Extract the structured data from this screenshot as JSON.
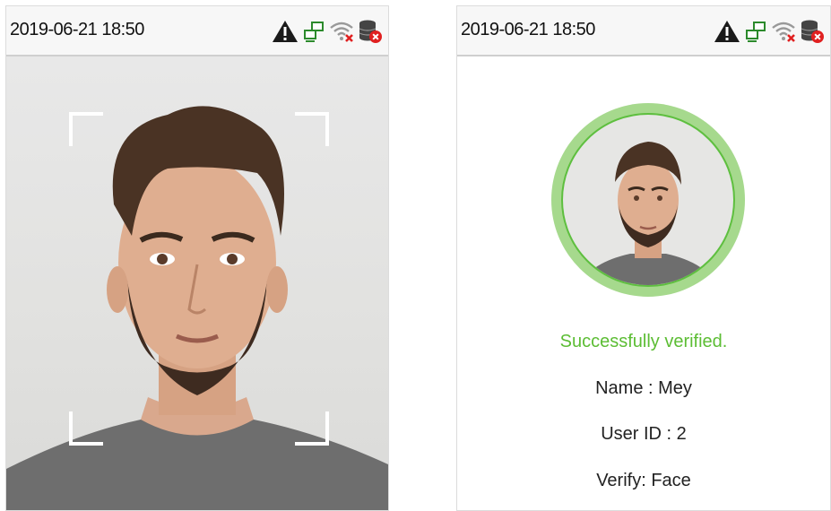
{
  "left_screen": {
    "status_bar": {
      "datetime": "2019-06-21 18:50"
    }
  },
  "right_screen": {
    "status_bar": {
      "datetime": "2019-06-21 18:50"
    },
    "result": {
      "message": "Successfully verified.",
      "name_line": "Name : Mey",
      "user_id_line": "User ID : 2",
      "verify_line": "Verify: Face"
    }
  },
  "colors": {
    "success_green": "#5cbd34",
    "ring_green": "#a6d98d",
    "corner_white": "#ffffff"
  },
  "icons": [
    "warning-icon",
    "network-icon",
    "wifi-disconnected-icon",
    "database-error-icon"
  ]
}
